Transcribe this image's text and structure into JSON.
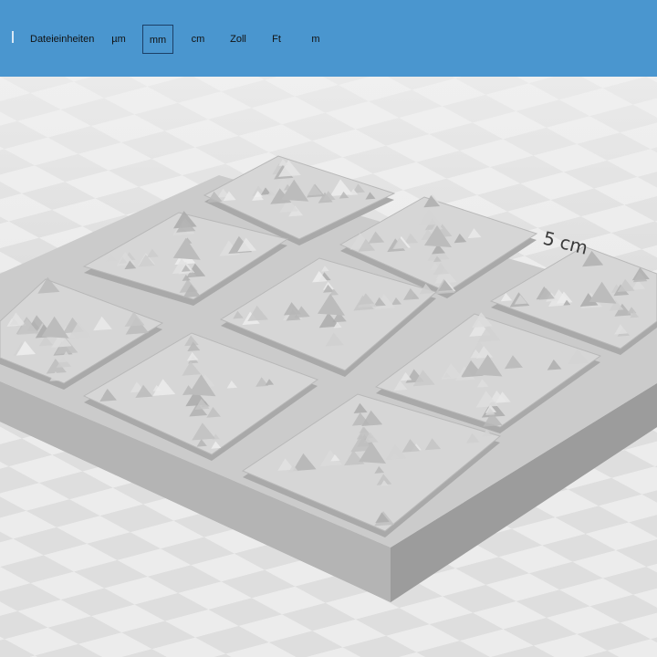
{
  "toolbar": {
    "label": "Dateieinheiten",
    "units": [
      "µm",
      "mm",
      "cm",
      "Zoll",
      "Ft",
      "m"
    ],
    "selected_unit": "mm"
  },
  "viewport": {
    "dimension_label": "5 cm",
    "tile_count": 9
  },
  "colors": {
    "toolbar": "#4a96cf",
    "canvas": "#e6e6e6",
    "model": "#c9c9c9"
  }
}
